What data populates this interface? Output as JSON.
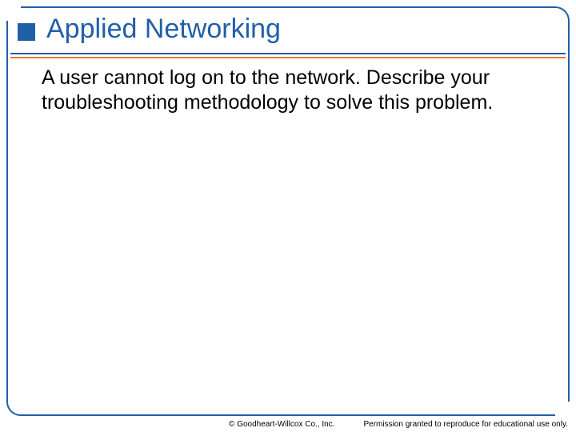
{
  "title": "Applied Networking",
  "body": "A user cannot log on to the network. Describe your troubleshooting methodology to solve this problem.",
  "footer": {
    "copyright": "© Goodheart-Willcox Co., Inc.",
    "permission": "Permission granted to reproduce for educational use only."
  }
}
